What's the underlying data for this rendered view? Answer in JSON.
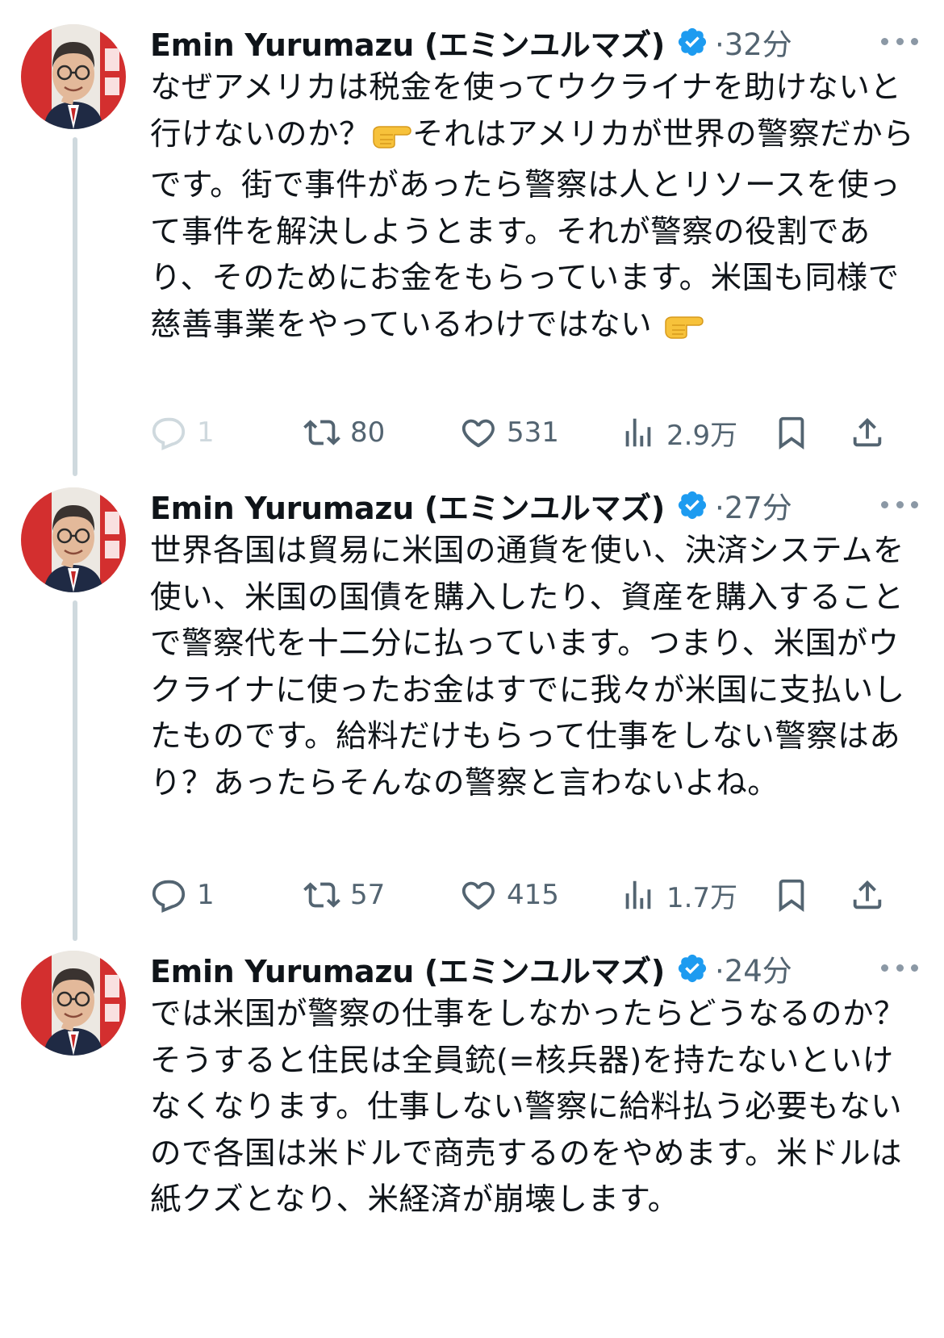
{
  "tweets": [
    {
      "author": "Emin Yurumazu (エミンユルマズ)",
      "time": "·32分",
      "text_before_emoji": "なぜアメリカは税金を使ってウクライナを助けないと行けないのか？",
      "text_mid": "それはアメリカが世界の警察だからです。街で事件があったら警察は人とリソースを使って事件を解決しようとます。それが警察の役割であり、そのためにお金をもらっています。米国も同様で慈善事業をやっているわけではない ",
      "emoji": "pointing-right-hand",
      "reply_count": "1",
      "retweet_count": "80",
      "like_count": "531",
      "view_count": "2.9万"
    },
    {
      "author": "Emin Yurumazu (エミンユルマズ)",
      "time": "·27分",
      "text": "世界各国は貿易に米国の通貨を使い、決済システムを使い、米国の国債を購入したり、資産を購入することで警察代を十二分に払っています。つまり、米国がウクライナに使ったお金はすでに我々が米国に支払いしたものです。給料だけもらって仕事をしない警察はあり？あったらそんなの警察と言わないよね。",
      "reply_count": "1",
      "retweet_count": "57",
      "like_count": "415",
      "view_count": "1.7万"
    },
    {
      "author": "Emin Yurumazu (エミンユルマズ)",
      "time": "·24分",
      "text": "では米国が警察の仕事をしなかったらどうなるのか？そうすると住民は全員銃(=核兵器)を持たないといけなくなります。仕事しない警察に給料払う必要もないので各国は米ドルで商売するのをやめます。米ドルは紙クズとなり、米経済が崩壊します。"
    }
  ],
  "colors": {
    "text": "#0f1419",
    "secondary": "#536471",
    "verified": "#1d9bf0",
    "thread_line": "#cfd9de",
    "avatar_bg": "#d32f2f"
  },
  "icons": [
    "reply-icon",
    "retweet-icon",
    "like-icon",
    "views-icon",
    "bookmark-icon",
    "share-icon",
    "verified-badge-icon",
    "more-icon"
  ]
}
